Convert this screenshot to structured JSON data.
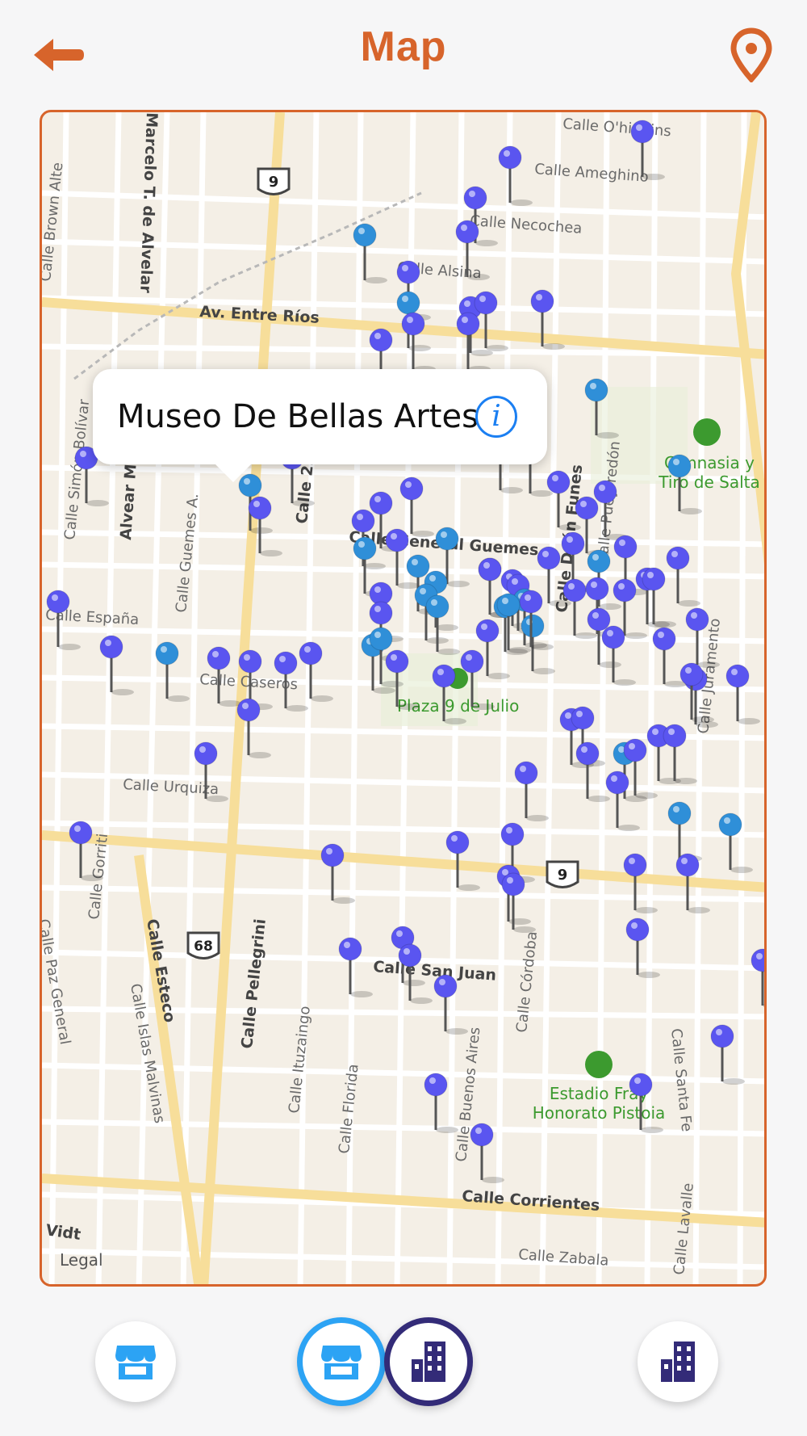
{
  "nav": {
    "title": "Map",
    "back_icon": "back-arrow-icon",
    "location_icon": "map-pin-icon",
    "accent_color": "#d7642b"
  },
  "map": {
    "legal_label": "Legal",
    "streets": [
      "Calle O'higgins",
      "Calle Ameghino",
      "Calle Necochea",
      "Calle Alsina",
      "Av. Entre Ríos",
      "Marcelo T. de Alvelar",
      "Calle Brown Alte",
      "Calle Simón Bolívar",
      "Alvear M. T.",
      "Calle Guemes A.",
      "Calle 25 de Mayo",
      "Calle General Guemes",
      "Calle España",
      "Calle Caseros",
      "Calle Urquiza",
      "Calle Gorriti",
      "Calle Esteco",
      "Calle Pellegrini",
      "Calle Ituzaingo",
      "Calle Florida",
      "Calle Buenos Aires",
      "Calle Córdoba",
      "Calle San Juan",
      "Calle Islas Malvinas",
      "Calle Paz General",
      "Calle Corrientes",
      "Calle Zabala",
      "Calle Santa Fe",
      "Calle Lavalle",
      "Calle Juramento",
      "Calle Pueyrredón",
      "Calle Deán Funes",
      "Vidt"
    ],
    "route_shields": [
      "9",
      "9",
      "68"
    ],
    "pois": [
      {
        "label": "Plaza 9 de Julio"
      },
      {
        "label_lines": [
          "Gimnasia y",
          "Tiro de Salta"
        ]
      },
      {
        "label_lines": [
          "Estadio Fray",
          "Honorato Pistoia"
        ]
      }
    ],
    "pin_colors": {
      "purple": "#5a55f0",
      "teal": "#2f8fd8"
    },
    "callout": {
      "title": "Museo De Bellas Artes",
      "info_icon": "info-icon"
    }
  },
  "bottom_bar": {
    "buttons": [
      {
        "icon": "store-icon",
        "state": "inactive"
      },
      {
        "icon": "store-icon",
        "state": "active"
      },
      {
        "icon": "building-icon",
        "state": "active"
      },
      {
        "icon": "building-icon",
        "state": "inactive"
      }
    ],
    "store_color": "#2ca3f4",
    "building_color": "#332b78"
  }
}
